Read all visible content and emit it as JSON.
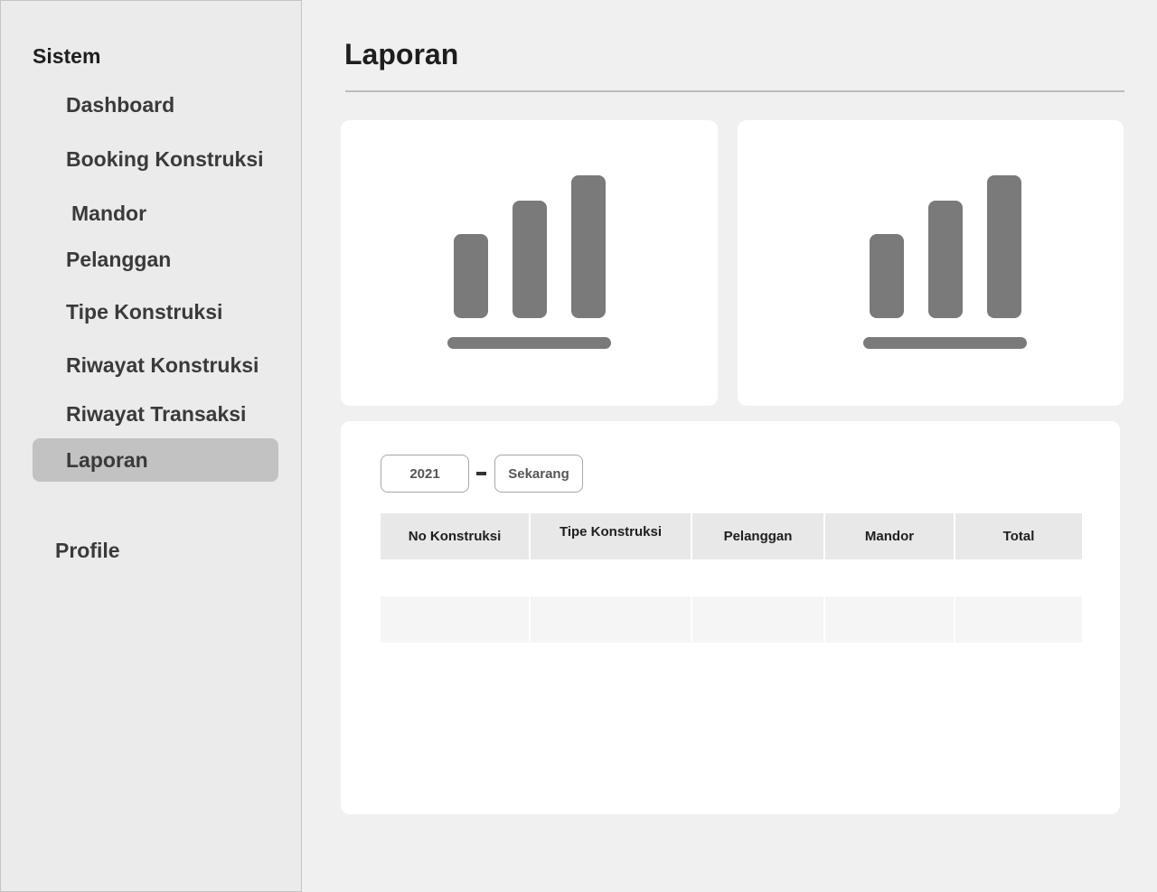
{
  "sidebar": {
    "title": "Sistem",
    "items": [
      {
        "label": "Dashboard"
      },
      {
        "label": "Booking Konstruksi"
      },
      {
        "label": "Mandor"
      },
      {
        "label": "Pelanggan"
      },
      {
        "label": "Tipe Konstruksi"
      },
      {
        "label": "Riwayat Konstruksi"
      },
      {
        "label": "Riwayat Transaksi"
      },
      {
        "label": "Laporan",
        "active": true
      }
    ],
    "profile_label": "Profile"
  },
  "main": {
    "title": "Laporan",
    "charts": [
      {
        "icon": "bar-chart-icon"
      },
      {
        "icon": "bar-chart-icon"
      }
    ],
    "filter": {
      "from": "2021",
      "to": "Sekarang"
    },
    "table": {
      "columns": [
        "No Konstruksi",
        "Tipe Konstruksi",
        "Pelanggan",
        "Mandor",
        "Total"
      ],
      "rows": [
        [
          "",
          "",
          "",
          "",
          ""
        ]
      ]
    }
  },
  "colors": {
    "icon_gray": "#7a7a7a",
    "active_item": "#c2c2c2"
  }
}
